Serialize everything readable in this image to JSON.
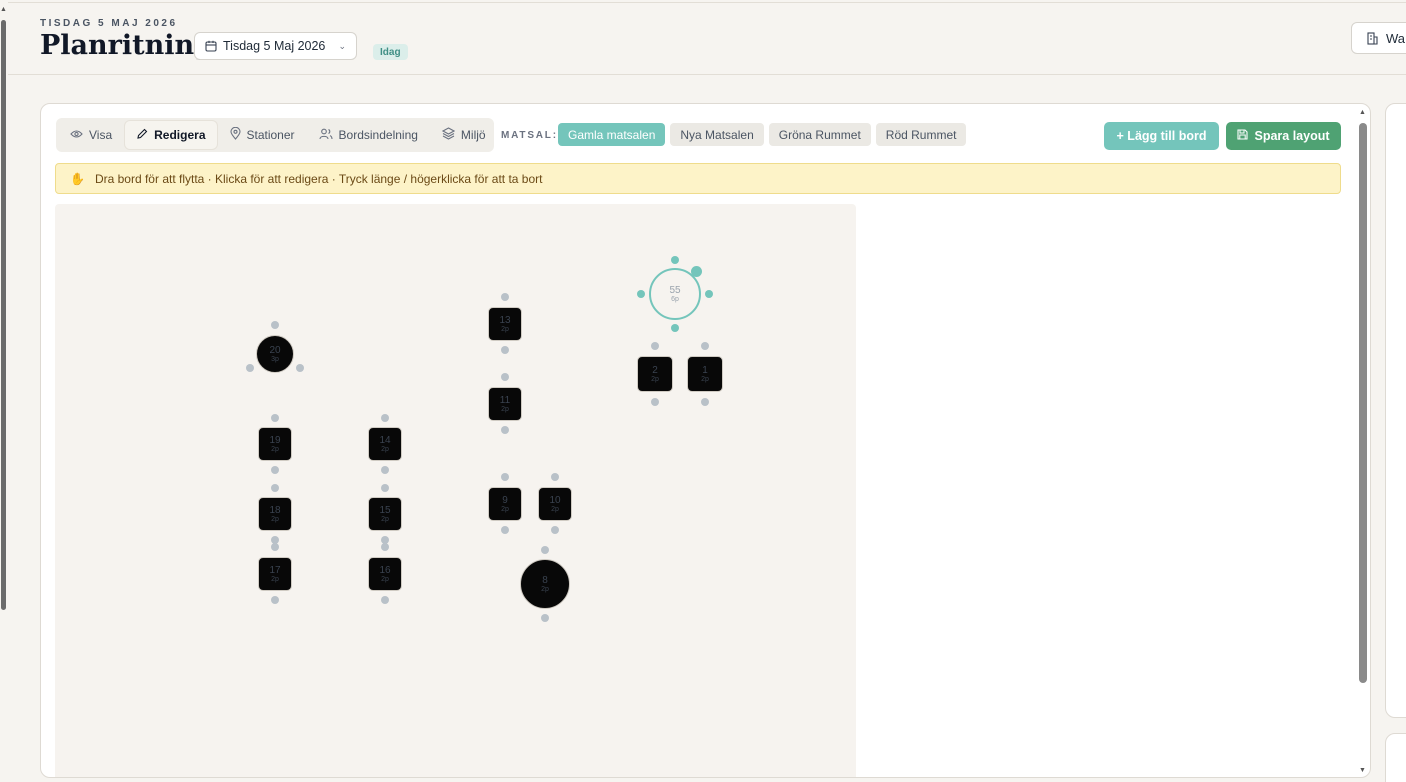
{
  "header": {
    "eyebrow": "TISDAG 5 MAJ 2026",
    "title": "Planritning",
    "date_label": "Tisdag 5 Maj 2026",
    "today_badge": "Idag",
    "right_button_label": "Wa"
  },
  "toolbar": {
    "modes": [
      {
        "label": "Visa",
        "icon": "eye-icon",
        "active": false
      },
      {
        "label": "Redigera",
        "icon": "pencil-icon",
        "active": true
      },
      {
        "label": "Stationer",
        "icon": "map-pin-icon",
        "active": false
      },
      {
        "label": "Bordsindelning",
        "icon": "users-icon",
        "active": false
      },
      {
        "label": "Miljö",
        "icon": "layers-icon",
        "active": false
      }
    ],
    "matsal_label": "MATSAL:",
    "rooms": [
      {
        "label": "Gamla matsalen",
        "active": true
      },
      {
        "label": "Nya Matsalen",
        "active": false
      },
      {
        "label": "Gröna Rummet",
        "active": false
      },
      {
        "label": "Röd Rummet",
        "active": false
      }
    ],
    "add_table_label": "+ Lägg till bord",
    "save_layout_label": "Spara layout"
  },
  "hint": {
    "icon": "hand-icon",
    "text": "Dra bord för att flytta · Klicka för att redigera · Tryck länge / högerklicka för att ta bort"
  },
  "colors": {
    "accent": "#74c5bb",
    "save_green": "#4fa273",
    "hint_bg": "#fdf3c8",
    "table_fill": "#080808"
  },
  "tables": [
    {
      "number": "20",
      "capacity": "3p",
      "shape": "round"
    },
    {
      "number": "19",
      "capacity": "2p",
      "shape": "square"
    },
    {
      "number": "18",
      "capacity": "2p",
      "shape": "square"
    },
    {
      "number": "17",
      "capacity": "2p",
      "shape": "square"
    },
    {
      "number": "14",
      "capacity": "2p",
      "shape": "square"
    },
    {
      "number": "15",
      "capacity": "2p",
      "shape": "square"
    },
    {
      "number": "16",
      "capacity": "2p",
      "shape": "square"
    },
    {
      "number": "13",
      "capacity": "2p",
      "shape": "square"
    },
    {
      "number": "11",
      "capacity": "2p",
      "shape": "square"
    },
    {
      "number": "9",
      "capacity": "2p",
      "shape": "square"
    },
    {
      "number": "10",
      "capacity": "2p",
      "shape": "square"
    },
    {
      "number": "8",
      "capacity": "2p",
      "shape": "round"
    },
    {
      "number": "55",
      "capacity": "6p",
      "shape": "round",
      "selected": true
    },
    {
      "number": "2",
      "capacity": "2p",
      "shape": "square"
    },
    {
      "number": "1",
      "capacity": "2p",
      "shape": "square"
    }
  ]
}
